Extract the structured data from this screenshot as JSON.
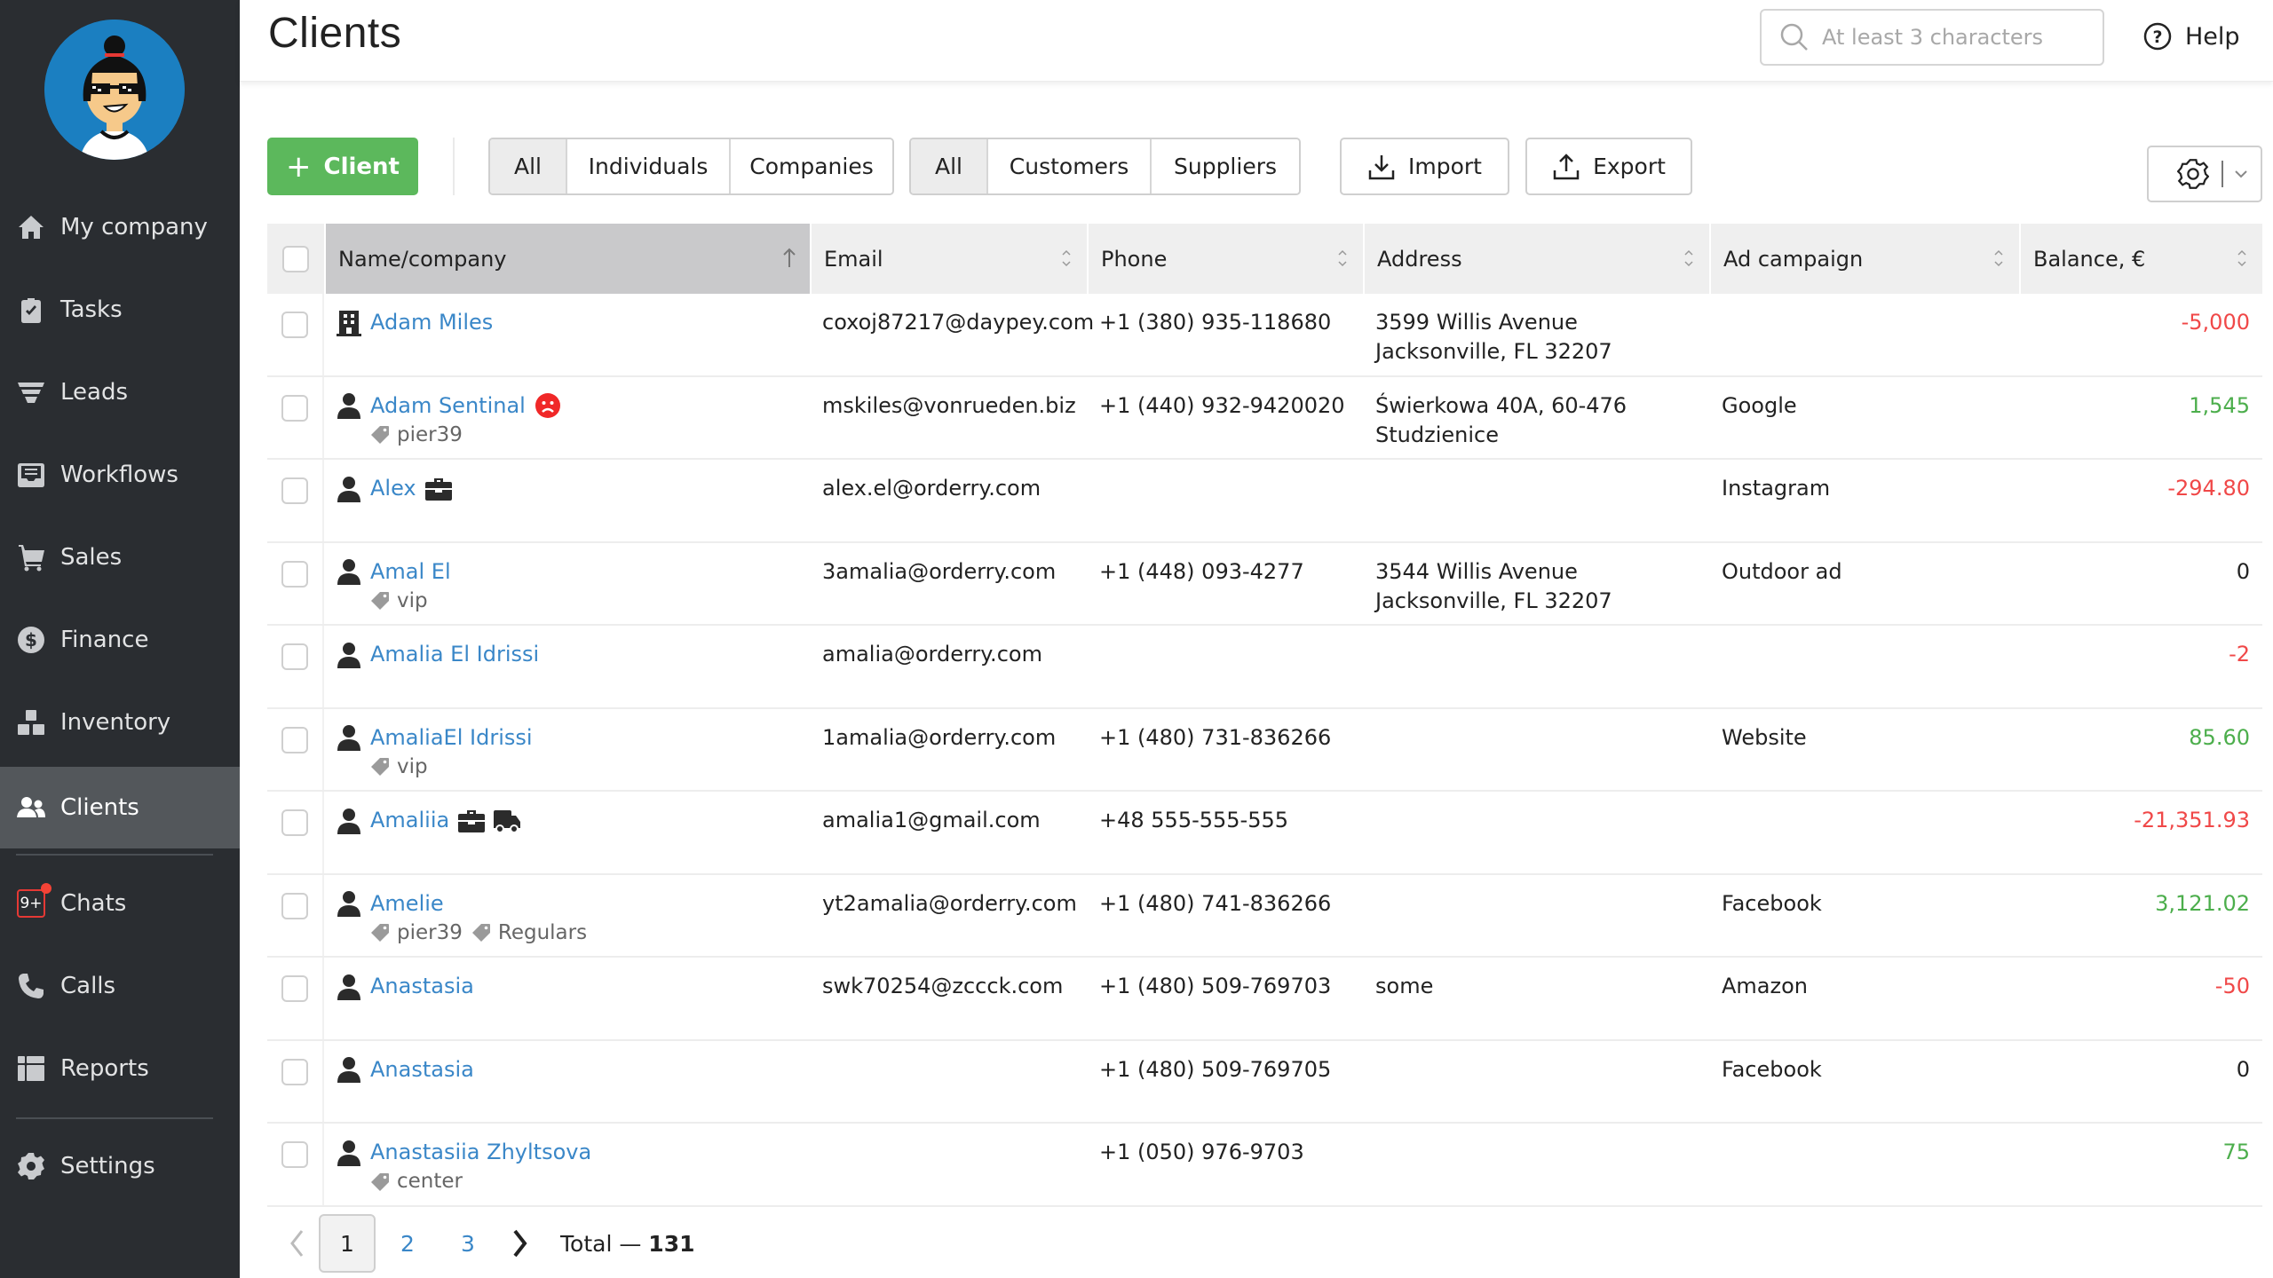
{
  "sidebar": {
    "items": [
      {
        "label": "My company",
        "icon": "home-icon"
      },
      {
        "label": "Tasks",
        "icon": "clipboard-check-icon"
      },
      {
        "label": "Leads",
        "icon": "funnel-icon"
      },
      {
        "label": "Workflows",
        "icon": "inbox-icon"
      },
      {
        "label": "Sales",
        "icon": "cart-icon"
      },
      {
        "label": "Finance",
        "icon": "dollar-circle-icon"
      },
      {
        "label": "Inventory",
        "icon": "boxes-icon"
      },
      {
        "label": "Clients",
        "icon": "users-icon",
        "active": true
      },
      {
        "label": "Chats",
        "icon": "chat-badge-icon",
        "badge": "9+"
      },
      {
        "label": "Calls",
        "icon": "phone-icon"
      },
      {
        "label": "Reports",
        "icon": "table-icon"
      },
      {
        "label": "Settings",
        "icon": "gear-icon"
      }
    ]
  },
  "header": {
    "title": "Clients",
    "search_placeholder": "At least 3 characters",
    "help_label": "Help"
  },
  "toolbar": {
    "add_client_label": "Client",
    "type_filter": [
      "All",
      "Individuals",
      "Companies"
    ],
    "type_filter_selected": "All",
    "role_filter": [
      "All",
      "Customers",
      "Suppliers"
    ],
    "role_filter_selected": "All",
    "import_label": "Import",
    "export_label": "Export"
  },
  "table": {
    "columns": [
      "Name/company",
      "Email",
      "Phone",
      "Address",
      "Ad campaign",
      "Balance, €"
    ],
    "sorted_column": "Name/company",
    "sort_direction": "ascending",
    "rows": [
      {
        "type": "company",
        "name": "Adam Miles",
        "icons": [],
        "tags": [],
        "email": "coxoj87217@daypey.com",
        "phone": "+1 (380) 935-118680",
        "address": "3599 Willis Avenue Jacksonville, FL 32207",
        "ad_campaign": "",
        "balance": "-5,000",
        "balance_sign": "neg"
      },
      {
        "type": "person",
        "name": "Adam Sentinal",
        "icons": [
          "sad-face-icon"
        ],
        "tags": [
          "pier39"
        ],
        "email": "mskiles@vonrueden.biz",
        "phone": "+1 (440) 932-9420020",
        "address": "Świerkowa 40A, 60-476 Studzienice",
        "ad_campaign": "Google",
        "balance": "1,545",
        "balance_sign": "pos"
      },
      {
        "type": "person",
        "name": "Alex",
        "icons": [
          "briefcase-icon"
        ],
        "tags": [],
        "email": "alex.el@orderry.com",
        "phone": "",
        "address": "",
        "ad_campaign": "Instagram",
        "balance": "-294.80",
        "balance_sign": "neg"
      },
      {
        "type": "person",
        "name": "Amal El",
        "icons": [],
        "tags": [
          "vip"
        ],
        "email": "3amalia@orderry.com",
        "phone": "+1 (448) 093-4277",
        "address": "3544 Willis Avenue Jacksonville, FL 32207",
        "ad_campaign": "Outdoor ad",
        "balance": "0",
        "balance_sign": "zero"
      },
      {
        "type": "person",
        "name": "Amalia El Idrissi",
        "icons": [],
        "tags": [],
        "email": "amalia@orderry.com",
        "phone": "",
        "address": "",
        "ad_campaign": "",
        "balance": "-2",
        "balance_sign": "neg"
      },
      {
        "type": "person",
        "name": "AmaliaEl Idrissi",
        "icons": [],
        "tags": [
          "vip"
        ],
        "email": "1amalia@orderry.com",
        "phone": "+1 (480) 731-836266",
        "address": "",
        "ad_campaign": "Website",
        "balance": "85.60",
        "balance_sign": "pos"
      },
      {
        "type": "person",
        "name": "Amaliia",
        "icons": [
          "briefcase-icon",
          "truck-icon"
        ],
        "tags": [],
        "email": "amalia1@gmail.com",
        "phone": "+48 555-555-555",
        "address": "",
        "ad_campaign": "",
        "balance": "-21,351.93",
        "balance_sign": "neg"
      },
      {
        "type": "person",
        "name": "Amelie",
        "icons": [],
        "tags": [
          "pier39",
          "Regulars"
        ],
        "email": "yt2amalia@orderry.com",
        "phone": "+1 (480) 741-836266",
        "address": "",
        "ad_campaign": "Facebook",
        "balance": "3,121.02",
        "balance_sign": "pos"
      },
      {
        "type": "person",
        "name": "Anastasia",
        "icons": [],
        "tags": [],
        "email": "swk70254@zccck.com",
        "phone": "+1 (480) 509-769703",
        "address": "some",
        "ad_campaign": "Amazon",
        "balance": "-50",
        "balance_sign": "neg"
      },
      {
        "type": "person",
        "name": "Anastasia",
        "icons": [],
        "tags": [],
        "email": "",
        "phone": "+1 (480) 509-769705",
        "address": "",
        "ad_campaign": "Facebook",
        "balance": "0",
        "balance_sign": "zero"
      },
      {
        "type": "person",
        "name": "Anastasiia Zhyltsova",
        "icons": [],
        "tags": [
          "center"
        ],
        "email": "",
        "phone": "+1 (050) 976-9703",
        "address": "",
        "ad_campaign": "",
        "balance": "75",
        "balance_sign": "pos"
      }
    ]
  },
  "pagination": {
    "pages": [
      "1",
      "2",
      "3"
    ],
    "current_page": "1",
    "total_label": "Total —",
    "total_count": "131"
  },
  "colors": {
    "sidebar_bg": "#2a2d31",
    "sidebar_active": "#53575b",
    "primary_green": "#5cb85c",
    "link_blue": "#3a87c8",
    "negative": "#f04848",
    "positive": "#4cae4c"
  }
}
